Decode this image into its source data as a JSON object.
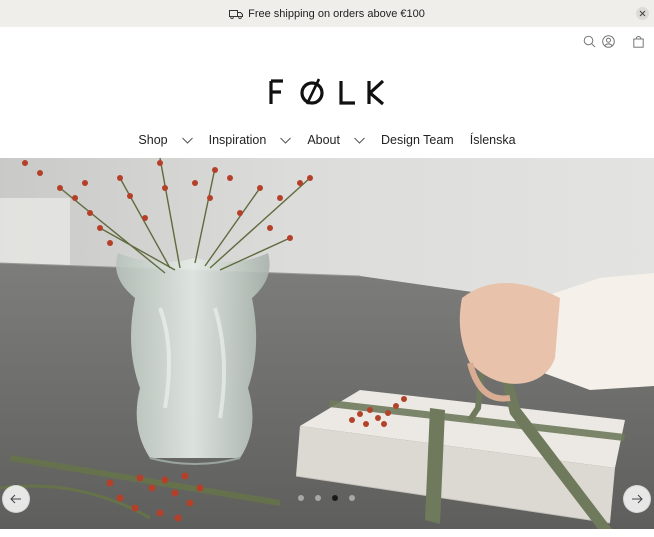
{
  "announcement": {
    "text": "Free shipping on orders above €100",
    "icon": "truck-icon",
    "close_icon": "close-icon"
  },
  "header": {
    "logo": "FØLK",
    "icons": [
      "search-icon",
      "account-icon",
      "cart-icon"
    ]
  },
  "nav": {
    "items": [
      {
        "label": "Shop",
        "dropdown": true
      },
      {
        "label": "Inspiration",
        "dropdown": true
      },
      {
        "label": "About",
        "dropdown": true
      },
      {
        "label": "Design Team",
        "dropdown": false
      },
      {
        "label": "Íslenska",
        "dropdown": false
      }
    ]
  },
  "slideshow": {
    "slides": 4,
    "active_slide": 3,
    "prev_icon": "arrow-left-icon",
    "next_icon": "arrow-right-icon"
  }
}
